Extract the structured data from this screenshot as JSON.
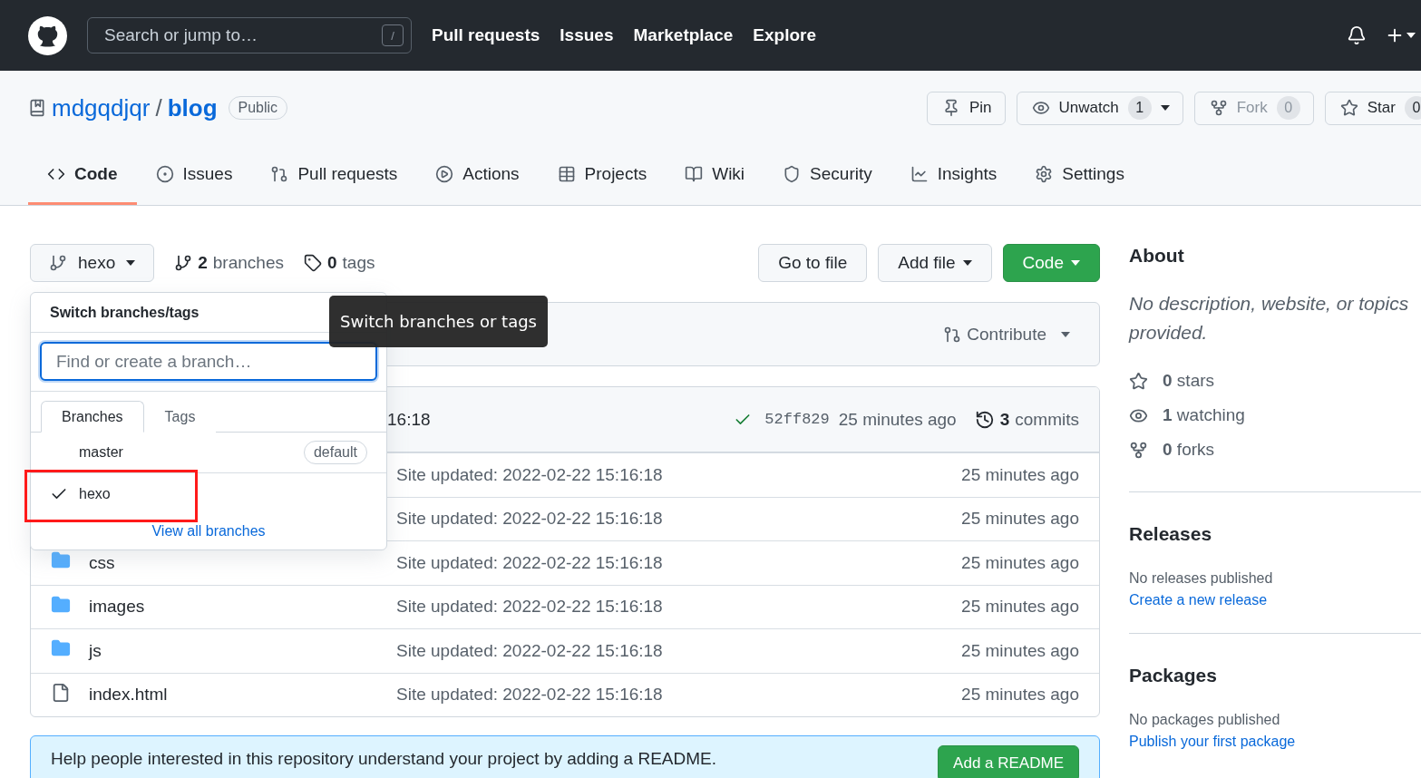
{
  "header": {
    "search": {
      "placeholder": "Search or jump to…",
      "shortcut": "/"
    },
    "nav": [
      "Pull requests",
      "Issues",
      "Marketplace",
      "Explore"
    ]
  },
  "repo": {
    "owner": "mdgqdjqr",
    "separator": "/",
    "name": "blog",
    "visibility": "Public",
    "actions": [
      {
        "kind": "pin",
        "label": "Pin",
        "disabled": false,
        "menu": false
      },
      {
        "kind": "watch",
        "label": "Unwatch",
        "count": "1",
        "disabled": false,
        "menu": true
      },
      {
        "kind": "fork",
        "label": "Fork",
        "count": "0",
        "disabled": true,
        "menu": false
      },
      {
        "kind": "star",
        "label": "Star",
        "count": "0",
        "disabled": false,
        "menu": false
      }
    ],
    "tabs": [
      {
        "kind": "code",
        "label": "Code",
        "selected": true
      },
      {
        "kind": "issues",
        "label": "Issues",
        "selected": false
      },
      {
        "kind": "pulls",
        "label": "Pull requests",
        "selected": false
      },
      {
        "kind": "actions",
        "label": "Actions",
        "selected": false
      },
      {
        "kind": "projects",
        "label": "Projects",
        "selected": false
      },
      {
        "kind": "wiki",
        "label": "Wiki",
        "selected": false
      },
      {
        "kind": "security",
        "label": "Security",
        "selected": false
      },
      {
        "kind": "insights",
        "label": "Insights",
        "selected": false
      },
      {
        "kind": "settings",
        "label": "Settings",
        "selected": false
      }
    ]
  },
  "branch_bar": {
    "current_branch": "hexo",
    "branches_count": "2",
    "branches_label": "branches",
    "tags_count": "0",
    "tags_label": "tags",
    "buttons": [
      {
        "kind": "plain",
        "label": "Go to file",
        "menu": false
      },
      {
        "kind": "plain",
        "label": "Add file",
        "menu": true
      },
      {
        "kind": "primary",
        "label": "Code",
        "menu": true
      }
    ]
  },
  "contribute": {
    "label": "Contribute"
  },
  "commit_bar": {
    "message": "16:18",
    "checks_passed": true,
    "hash": "52ff829",
    "time": "25 minutes ago",
    "commits_count": "3",
    "commits_label": "commits"
  },
  "files": [
    {
      "message": "Site updated: 2022-02-22 15:16:18",
      "time": "25 minutes ago"
    },
    {
      "message": "Site updated: 2022-02-22 15:16:18",
      "time": "25 minutes ago"
    },
    {
      "kind": "dir",
      "name": "css",
      "message": "Site updated: 2022-02-22 15:16:18",
      "time": "25 minutes ago"
    },
    {
      "kind": "dir",
      "name": "images",
      "message": "Site updated: 2022-02-22 15:16:18",
      "time": "25 minutes ago"
    },
    {
      "kind": "dir",
      "name": "js",
      "message": "Site updated: 2022-02-22 15:16:18",
      "time": "25 minutes ago"
    },
    {
      "kind": "file",
      "name": "index.html",
      "message": "Site updated: 2022-02-22 15:16:18",
      "time": "25 minutes ago"
    }
  ],
  "readme_banner": {
    "text": "Help people interested in this repository understand your project by adding a README.",
    "button": "Add a README"
  },
  "branch_menu": {
    "title": "Switch branches/tags",
    "search": {
      "placeholder": "Find or create a branch…"
    },
    "tabs": [
      {
        "label": "Branches",
        "selected": true
      },
      {
        "label": "Tags",
        "selected": false
      }
    ],
    "branches": [
      {
        "name": "master",
        "badge": "default",
        "checked": false
      },
      {
        "name": "hexo",
        "checked": true
      }
    ],
    "footer_link": "View all branches"
  },
  "tooltip": {
    "text": "Switch branches or tags"
  },
  "annotations": [
    {
      "kind": "rectangle"
    }
  ],
  "sidebar": {
    "about": {
      "title": "About",
      "description": "No description, website, or topics provided.",
      "stats": [
        {
          "kind": "star",
          "count": "0",
          "label": "stars"
        },
        {
          "kind": "watch",
          "count": "1",
          "label": "watching"
        },
        {
          "kind": "fork",
          "count": "0",
          "label": "forks"
        }
      ]
    },
    "releases": {
      "title": "Releases",
      "text": "No releases published",
      "link": "Create a new release"
    },
    "packages": {
      "title": "Packages",
      "text": "No packages published",
      "link": "Publish your first package"
    }
  }
}
